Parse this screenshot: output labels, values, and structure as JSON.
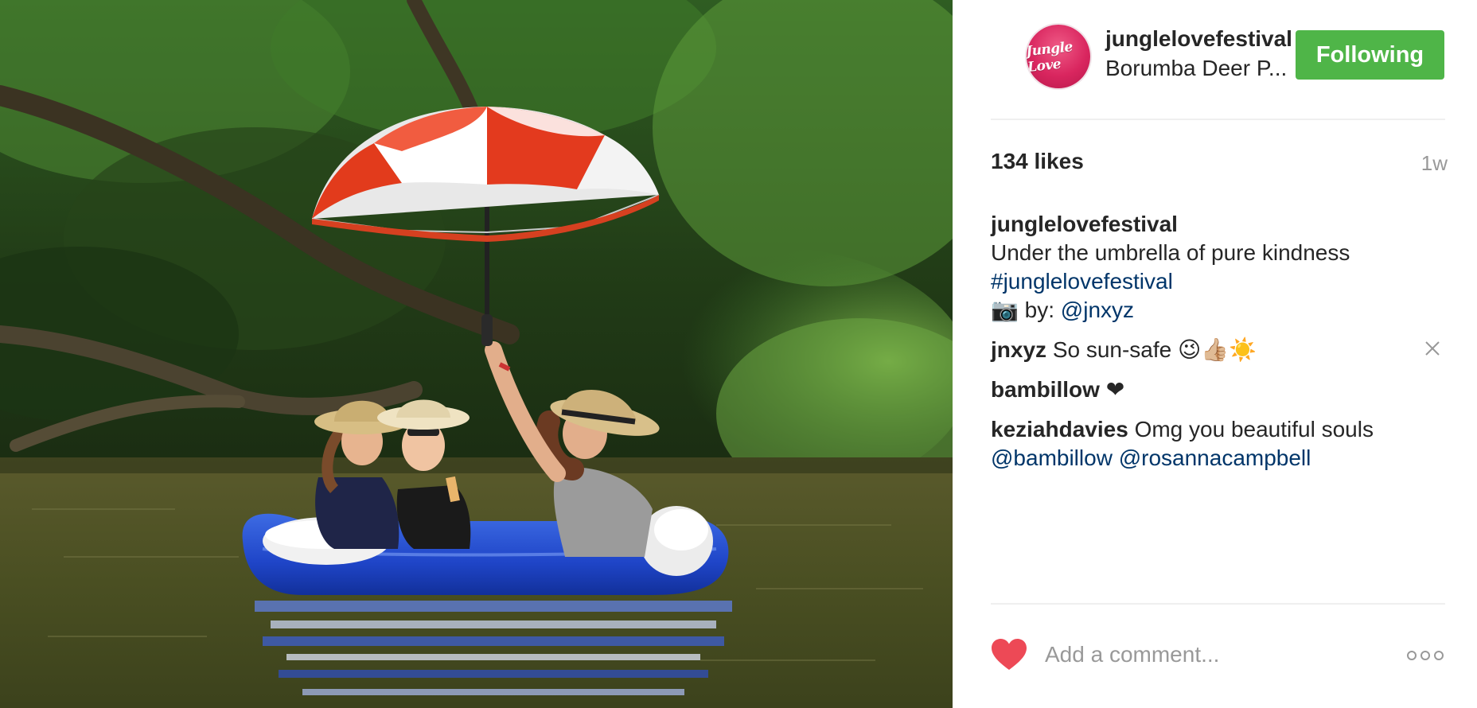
{
  "post": {
    "image_alt": "Three people on a blue inflatable raft under a red and white umbrella"
  },
  "header": {
    "avatar_text": "Jungle Love",
    "username": "junglelovefestival",
    "location": "Borumba Deer P...",
    "follow_label": "Following"
  },
  "stats": {
    "likes": "134 likes",
    "time": "1w"
  },
  "caption": {
    "author": "junglelovefestival",
    "text": "Under the umbrella of pure kindness",
    "hashtag": "#junglelovefestival",
    "credit_icon": "📷",
    "credit_prefix": " by: ",
    "credit_handle": "@jnxyz"
  },
  "comments": [
    {
      "author": "jnxyz",
      "text": "So sun-safe 😉👍🏼☀️"
    },
    {
      "author": "bambillow",
      "text": "❤"
    },
    {
      "author": "keziahdavies",
      "text": "Omg you beautiful souls",
      "mention1": "@bambillow",
      "mention2": "@rosannacampbell"
    }
  ],
  "footer": {
    "comment_placeholder": "Add a comment..."
  },
  "colors": {
    "follow_button": "#4fb548",
    "link": "#003569",
    "like_heart": "#ed4956",
    "muted": "#999999"
  },
  "icons": {
    "like": "heart-icon",
    "more": "more-options-icon",
    "delete": "close-icon",
    "camera": "camera-emoji"
  }
}
